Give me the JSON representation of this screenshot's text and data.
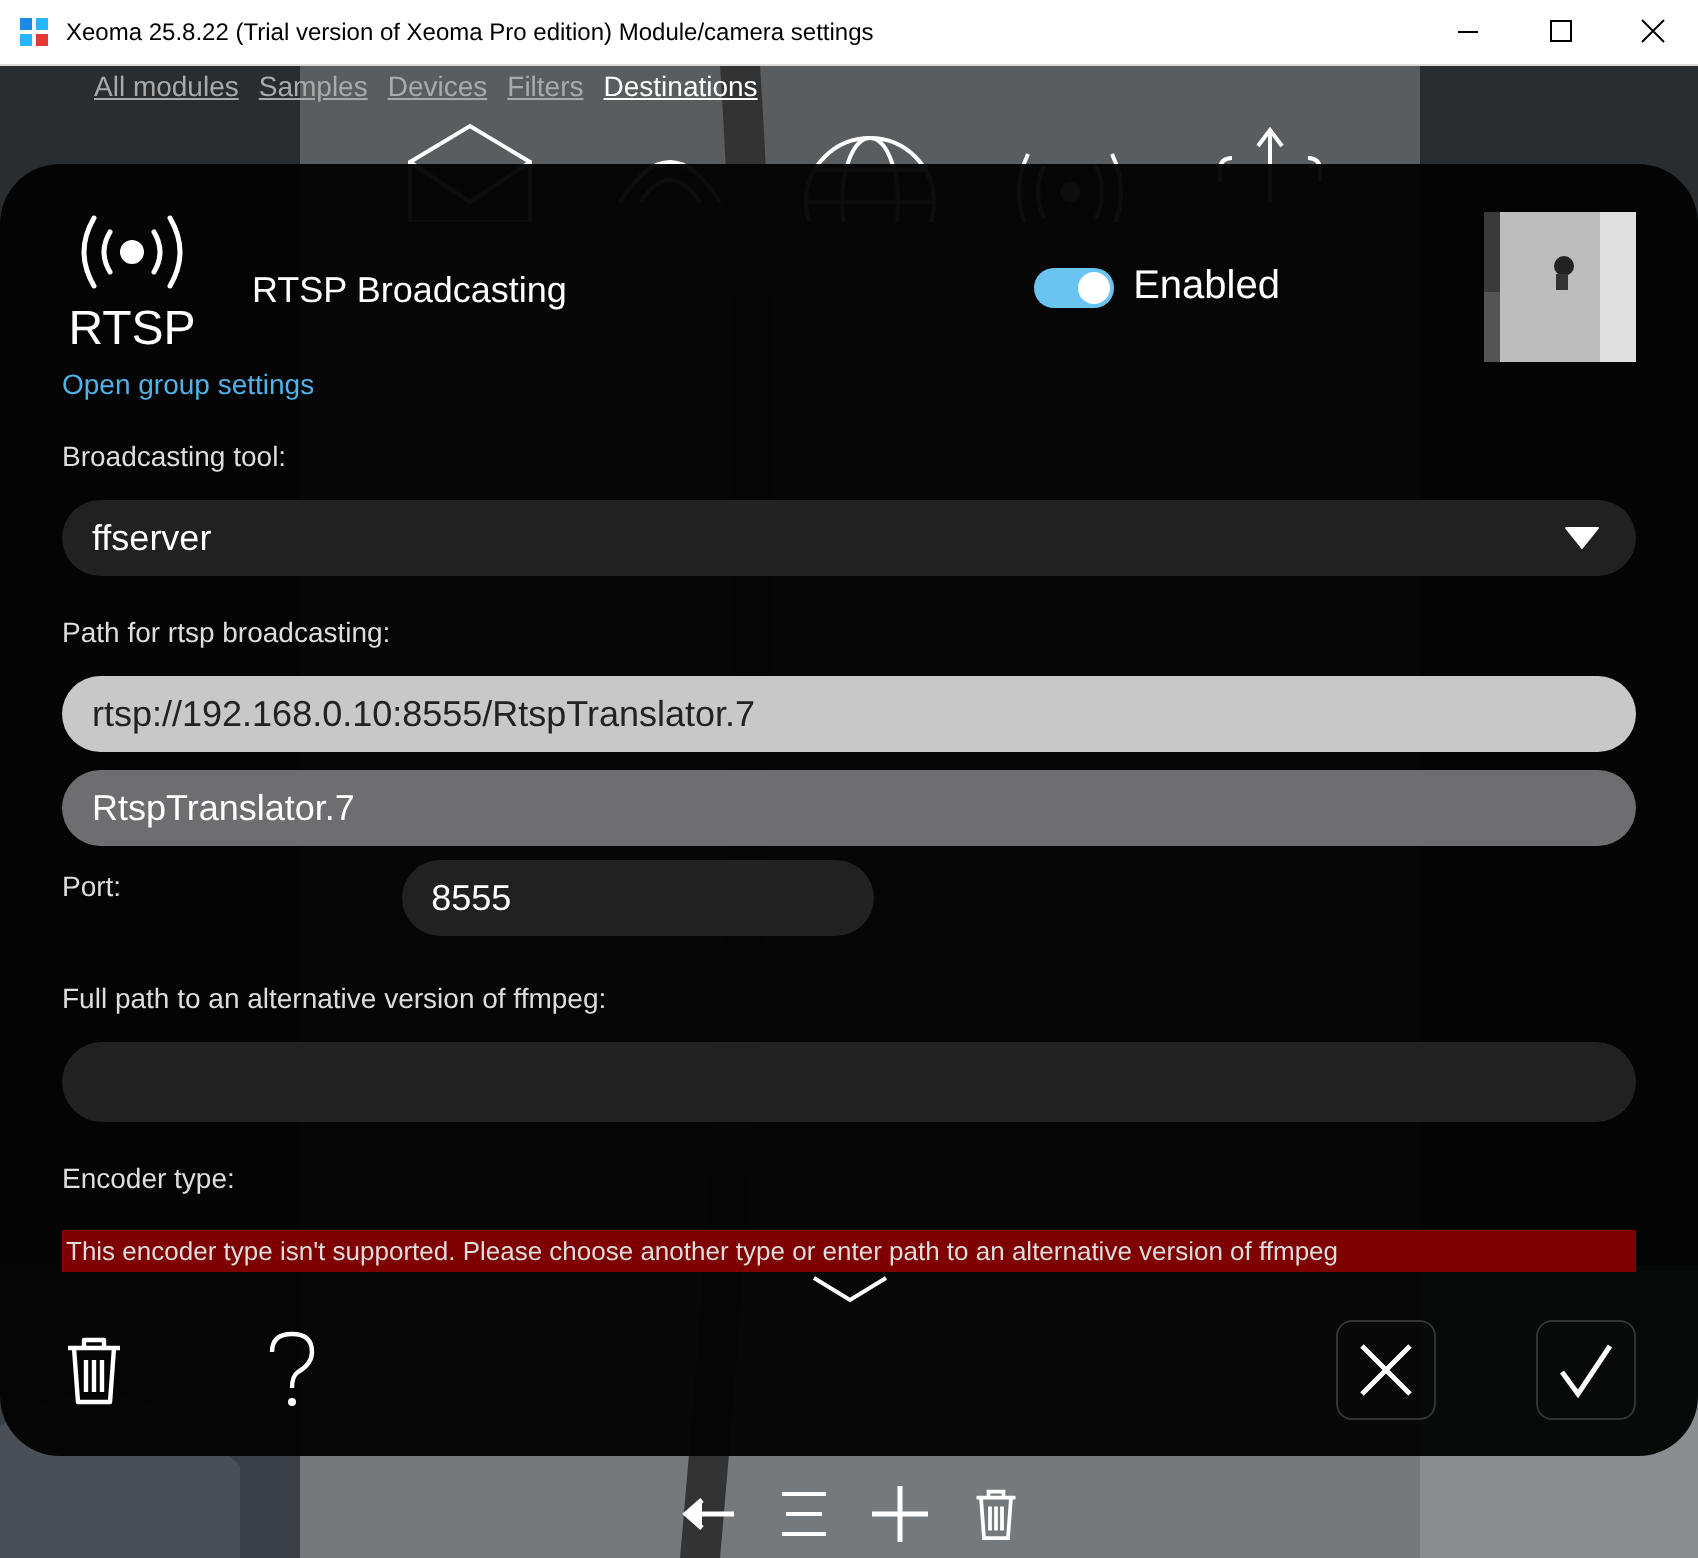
{
  "window": {
    "title": "Xeoma 25.8.22 (Trial version of Xeoma Pro edition) Module/camera settings"
  },
  "nav": [
    {
      "label": "All modules",
      "selected": false
    },
    {
      "label": "Samples",
      "selected": false
    },
    {
      "label": "Devices",
      "selected": false
    },
    {
      "label": "Filters",
      "selected": false
    },
    {
      "label": "Destinations",
      "selected": true
    }
  ],
  "dialog": {
    "module_label": "RTSP",
    "title": "RTSP Broadcasting",
    "enabled": {
      "label": "Enabled",
      "on": true
    },
    "group_link": "Open group settings",
    "fields": [
      {
        "kind": "select",
        "label": "Broadcasting tool:",
        "value": "ffserver"
      },
      {
        "kind": "light",
        "label": "Path for rtsp broadcasting:",
        "value": "rtsp://192.168.0.10:8555/RtspTranslator.7"
      },
      {
        "kind": "gray",
        "value": "RtspTranslator.7"
      },
      {
        "kind": "inline",
        "label": "Port:",
        "value": "8555"
      },
      {
        "kind": "text",
        "label": "Full path to an alternative version of ffmpeg:"
      },
      {
        "kind": "error",
        "label": "Encoder type:",
        "value": "This encoder type isn't supported. Please choose another type or enter path to an alternative version of ffmpeg"
      }
    ]
  }
}
